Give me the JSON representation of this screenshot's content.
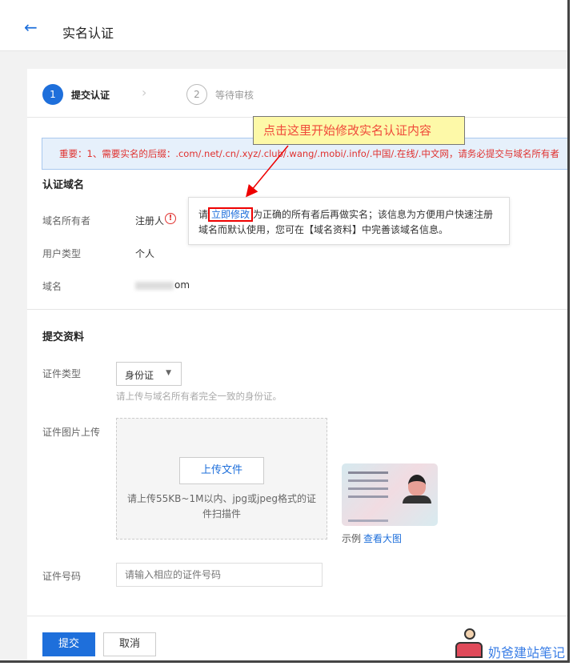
{
  "header": {
    "title": "实名认证"
  },
  "steps": [
    {
      "num": "1",
      "label": "提交认证",
      "active": true
    },
    {
      "num": "2",
      "label": "等待审核",
      "active": false
    }
  ],
  "notice": "重要：1、需要实名的后缀：.com/.net/.cn/.xyz/.club/.wang/.mobi/.info/.中国/.在线/.中文网，请务必提交与域名所有者",
  "callout": "点击这里开始修改实名认证内容",
  "domain_section": {
    "title": "认证域名",
    "owner_label": "域名所有者",
    "owner_value": "注册人",
    "user_type_label": "用户类型",
    "user_type_value": "个人",
    "domain_label": "域名",
    "domain_value": "om"
  },
  "tooltip": {
    "prefix": "请",
    "link": "立即修改",
    "suffix": "为正确的所有者后再做实名；该信息为方便用户快速注册域名而默认使用，您可在【域名资料】中完善该域名信息。"
  },
  "submit_section": {
    "title": "提交资料",
    "cert_type_label": "证件类型",
    "cert_type_value": "身份证",
    "cert_hint": "请上传与域名所有者完全一致的身份证。",
    "upload_label": "证件图片上传",
    "upload_button": "上传文件",
    "upload_hint": "请上传55KB~1M以内、jpg或jpeg格式的证件扫描件",
    "example_label": "示例",
    "example_link": "查看大图",
    "cert_no_label": "证件号码",
    "cert_no_placeholder": "请输入相应的证件号码"
  },
  "actions": {
    "submit": "提交",
    "cancel": "取消"
  },
  "watermark": "奶爸建站笔记",
  "colors": {
    "primary": "#1e6fdb",
    "danger": "#e0312f"
  }
}
